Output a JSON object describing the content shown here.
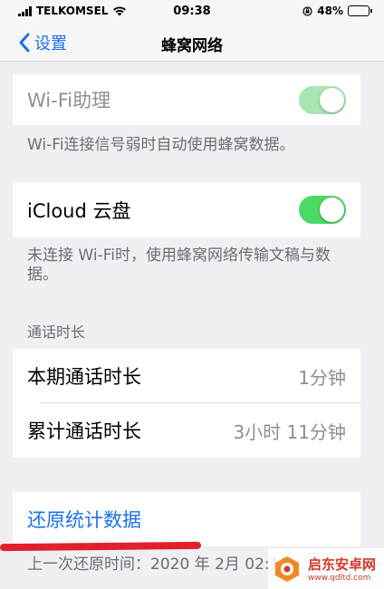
{
  "status_bar": {
    "carrier": "TELKOMSEL",
    "time": "09:38",
    "battery": "48%",
    "battery_level": 0.48
  },
  "nav": {
    "back_label": "设置",
    "title": "蜂窝网络"
  },
  "wifi_assist": {
    "label": "Wi-Fi助理",
    "toggle_on": true,
    "footnote": "Wi-Fi连接信号弱时自动使用蜂窝数据。"
  },
  "icloud_drive": {
    "label": "iCloud 云盘",
    "toggle_on": true,
    "footnote": "未连接 Wi-Fi时，使用蜂窝网络传输文稿与数据。"
  },
  "call_time": {
    "header": "通话时长",
    "current_period_label": "本期通话时长",
    "current_period_value": "1分钟",
    "lifetime_label": "累计通话时长",
    "lifetime_value": "3小时 11分钟"
  },
  "reset": {
    "label": "还原统计数据",
    "footnote": "上一次还原时间：2020 年 2月 02:13"
  },
  "watermark": {
    "name": "启东安卓网",
    "url": "www.qdltd.com"
  },
  "colors": {
    "accent": "#1a73e8",
    "toggle_on": "#4cd964",
    "background": "#efeff4",
    "annotation": "#e0202a"
  }
}
